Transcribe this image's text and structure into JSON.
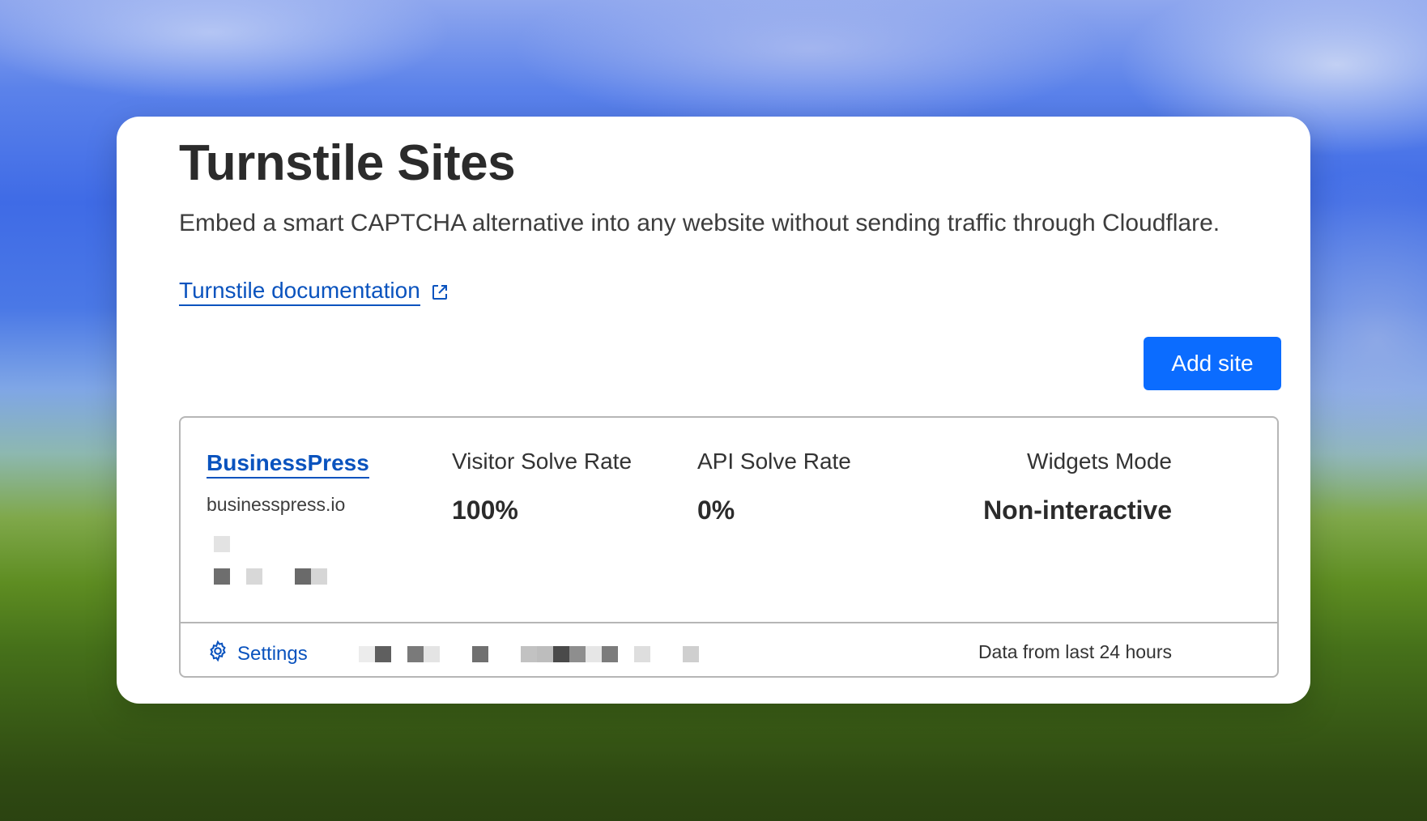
{
  "page": {
    "title": "Turnstile Sites",
    "description": "Embed a smart CAPTCHA alternative into any website without sending traffic through Cloudflare.",
    "doc_link": "Turnstile documentation",
    "add_site_label": "Add site",
    "link_icon": "external-link-icon"
  },
  "site": {
    "name": "BusinessPress",
    "domain": "businesspress.io",
    "metrics": [
      {
        "label": "Visitor Solve Rate",
        "value": "100%"
      },
      {
        "label": "API Solve Rate",
        "value": "0%"
      },
      {
        "label": "Widgets Mode",
        "value": "Non-interactive"
      }
    ],
    "settings_label": "Settings",
    "settings_icon": "gear-icon",
    "data_note": "Data from last 24 hours"
  },
  "colors": {
    "accent": "#0b6cff",
    "link": "#0a53be",
    "redaction_dark": "#6e6e6e",
    "redaction_light": "#dcdcdc"
  }
}
